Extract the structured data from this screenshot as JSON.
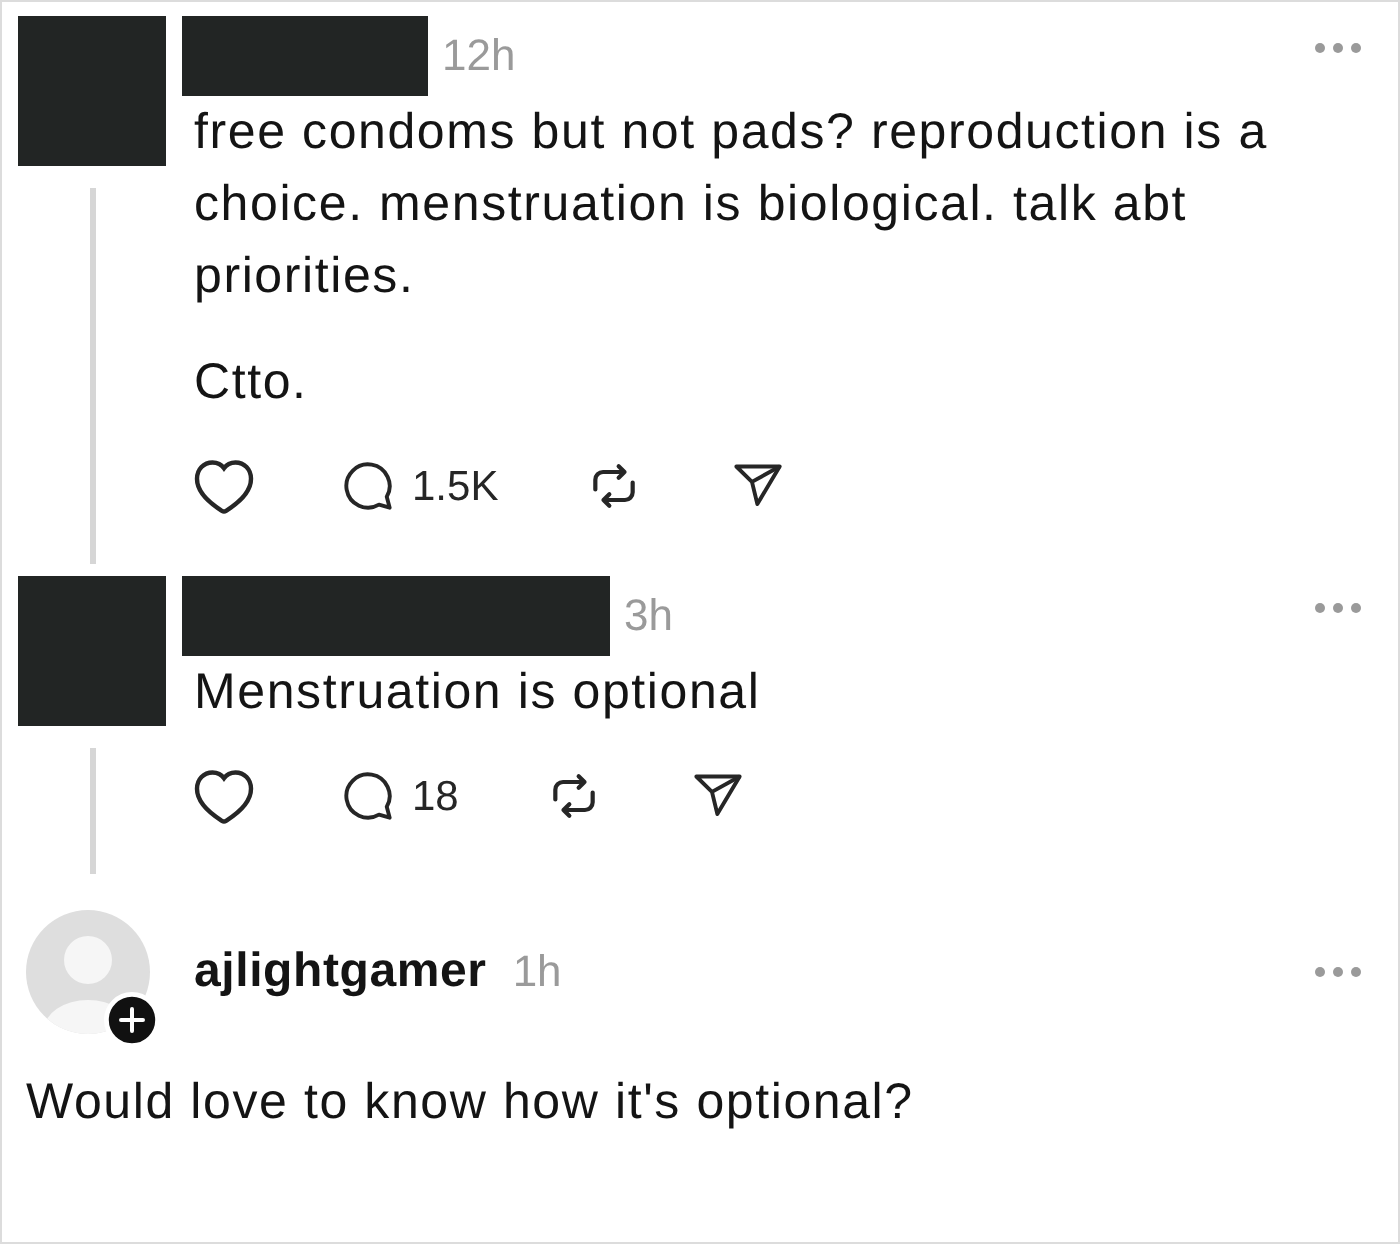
{
  "posts": [
    {
      "kind": "indented",
      "avatar": {
        "kind": "redacted"
      },
      "author": {
        "kind": "redacted"
      },
      "time": "12h",
      "paragraphs": [
        "free condoms but not pads? reproduction is a choice. menstruation is biological. talk abt priorities.",
        "Ctto."
      ],
      "reply_count": "1.5K"
    },
    {
      "kind": "indented",
      "avatar": {
        "kind": "redacted"
      },
      "author": {
        "kind": "redacted"
      },
      "time": "3h",
      "paragraphs": [
        "Menstruation is optional"
      ],
      "reply_count": "18"
    },
    {
      "kind": "full",
      "avatar": {
        "kind": "placeholder",
        "follow_badge": true
      },
      "author": {
        "kind": "name",
        "name": "ajlightgamer"
      },
      "time": "1h",
      "paragraphs": [
        "Would love to know how it's optional?"
      ]
    }
  ]
}
